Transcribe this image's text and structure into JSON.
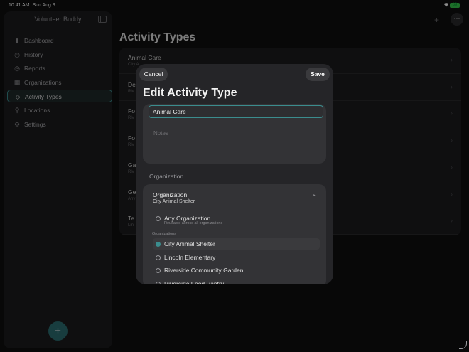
{
  "status": {
    "time": "10:41 AM",
    "date": "Sun Aug 9",
    "battery": "69"
  },
  "sidebar": {
    "title": "Volunteer Buddy",
    "items": [
      {
        "label": "Dashboard",
        "icon": "chart-bar-icon",
        "glyph": "▮"
      },
      {
        "label": "History",
        "icon": "clock-icon",
        "glyph": "◷"
      },
      {
        "label": "Reports",
        "icon": "clock-icon",
        "glyph": "◷"
      },
      {
        "label": "Organizations",
        "icon": "building-icon",
        "glyph": "▦"
      },
      {
        "label": "Activity Types",
        "icon": "tag-icon",
        "glyph": "◇",
        "active": true
      },
      {
        "label": "Locations",
        "icon": "pin-icon",
        "glyph": "⚲"
      },
      {
        "label": "Settings",
        "icon": "gear-icon",
        "glyph": "⚙"
      }
    ],
    "fab_label": "+"
  },
  "toolbar": {
    "add_label": "+",
    "more_label": "⋯"
  },
  "main": {
    "title": "Activity Types",
    "rows": [
      {
        "title": "Animal Care",
        "sub": "City A"
      },
      {
        "title": "De",
        "sub": "Riv"
      },
      {
        "title": "Fo",
        "sub": "Riv"
      },
      {
        "title": "Fo",
        "sub": "Riv"
      },
      {
        "title": "Ga",
        "sub": "Riv"
      },
      {
        "title": "Ge",
        "sub": "Any"
      },
      {
        "title": "Te",
        "sub": "Lin"
      }
    ],
    "row_chevron": "›"
  },
  "modal": {
    "cancel_label": "Cancel",
    "save_label": "Save",
    "title": "Edit Activity Type",
    "name_value": "Animal Care",
    "notes_placeholder": "Notes",
    "section_label": "Organization",
    "org_label": "Organization",
    "org_value": "City Animal Shelter",
    "org_chevron": "⌃",
    "any_option": "Any Organization",
    "any_sub": "Reusable across all organizations",
    "group_label": "Organizations",
    "options": [
      {
        "label": "City Animal Shelter",
        "selected": true
      },
      {
        "label": "Lincoln Elementary"
      },
      {
        "label": "Riverside Community Garden"
      },
      {
        "label": "Riverside Food Pantry"
      }
    ]
  },
  "colors": {
    "accent": "#3b8d8e",
    "fab": "#2c6f73",
    "background": "#0f0f0f",
    "sheet": "#252528"
  }
}
